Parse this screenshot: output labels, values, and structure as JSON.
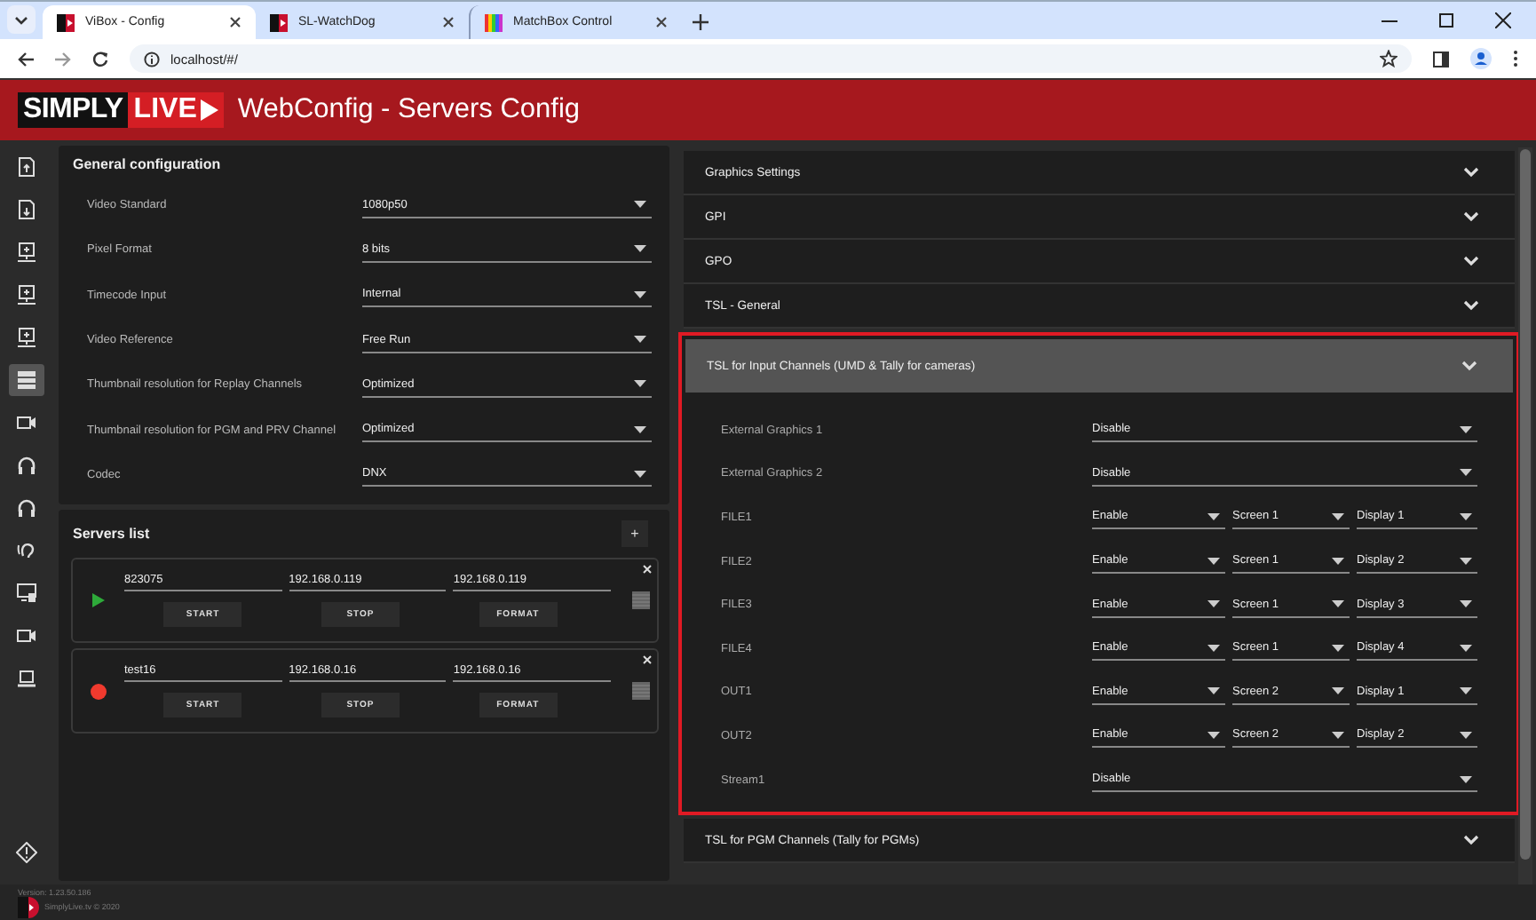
{
  "browser": {
    "tabs": [
      {
        "title": "ViBox - Config",
        "selected": true,
        "kind": "sl"
      },
      {
        "title": "SL-WatchDog",
        "selected": false,
        "kind": "sl"
      },
      {
        "title": "MatchBox Control",
        "selected": false,
        "kind": "bars"
      }
    ],
    "address": "localhost/#/"
  },
  "header": {
    "logo_left": "SIMPLY",
    "logo_right": "LIVE",
    "title": "WebConfig - Servers Config"
  },
  "sidebar": {
    "items": [
      {
        "kind": "file-up",
        "selected": false
      },
      {
        "kind": "file-down",
        "selected": false
      },
      {
        "kind": "monitor",
        "selected": false
      },
      {
        "kind": "monitor",
        "selected": false
      },
      {
        "kind": "monitor",
        "selected": false
      },
      {
        "kind": "list",
        "selected": true
      },
      {
        "kind": "camera",
        "selected": false
      },
      {
        "kind": "headset",
        "selected": false
      },
      {
        "kind": "headset",
        "selected": false
      },
      {
        "kind": "ear",
        "selected": false
      },
      {
        "kind": "screen",
        "selected": false
      },
      {
        "kind": "camera",
        "selected": false
      },
      {
        "kind": "laptop",
        "selected": false
      }
    ]
  },
  "general_configuration": {
    "title": "General configuration",
    "fields": [
      {
        "label": "Video Standard",
        "value": "1080p50"
      },
      {
        "label": "Pixel Format",
        "value": "8 bits"
      },
      {
        "label": "Timecode Input",
        "value": "Internal"
      },
      {
        "label": "Video Reference",
        "value": "Free Run"
      },
      {
        "label": "Thumbnail resolution for Replay Channels",
        "value": "Optimized"
      },
      {
        "label": "Thumbnail resolution for PGM and PRV Channel",
        "value": "Optimized"
      },
      {
        "label": "Codec",
        "value": "DNX"
      }
    ]
  },
  "servers_list": {
    "title": "Servers list",
    "add_label": "+",
    "servers": [
      {
        "kind": "playing",
        "fields": [
          "823075",
          "192.168.0.119",
          "192.168.0.119"
        ],
        "buttons": [
          "START",
          "STOP",
          "FORMAT"
        ]
      },
      {
        "kind": "stopped",
        "fields": [
          "test16",
          "192.168.0.16",
          "192.168.0.16"
        ],
        "buttons": [
          "START",
          "STOP",
          "FORMAT"
        ]
      }
    ]
  },
  "sections": [
    {
      "title": "Graphics Settings",
      "expanded": false,
      "highlighted": false
    },
    {
      "title": "GPI",
      "expanded": false,
      "highlighted": false
    },
    {
      "title": "GPO",
      "expanded": false,
      "highlighted": false
    },
    {
      "title": "TSL - General",
      "expanded": false,
      "highlighted": false
    },
    {
      "title": "TSL for Input Channels (UMD & Tally for cameras)",
      "expanded": true,
      "highlighted": true,
      "rows": [
        {
          "label": "External Graphics 1",
          "selects": [
            "Disable"
          ]
        },
        {
          "label": "External Graphics 2",
          "selects": [
            "Disable"
          ]
        },
        {
          "label": "FILE1",
          "selects": [
            "Enable",
            "Screen 1",
            "Display 1"
          ]
        },
        {
          "label": "FILE2",
          "selects": [
            "Enable",
            "Screen 1",
            "Display 2"
          ]
        },
        {
          "label": "FILE3",
          "selects": [
            "Enable",
            "Screen 1",
            "Display 3"
          ]
        },
        {
          "label": "FILE4",
          "selects": [
            "Enable",
            "Screen 1",
            "Display 4"
          ]
        },
        {
          "label": "OUT1",
          "selects": [
            "Enable",
            "Screen 2",
            "Display 1"
          ]
        },
        {
          "label": "OUT2",
          "selects": [
            "Enable",
            "Screen 2",
            "Display 2"
          ]
        },
        {
          "label": "Stream1",
          "selects": [
            "Disable"
          ]
        }
      ]
    },
    {
      "title": "TSL for PGM Channels (Tally for PGMs)",
      "expanded": false,
      "highlighted": false
    }
  ],
  "footer": {
    "version": "Version: 1.23.50.186",
    "copyright": "SimplyLive.tv © 2020"
  }
}
